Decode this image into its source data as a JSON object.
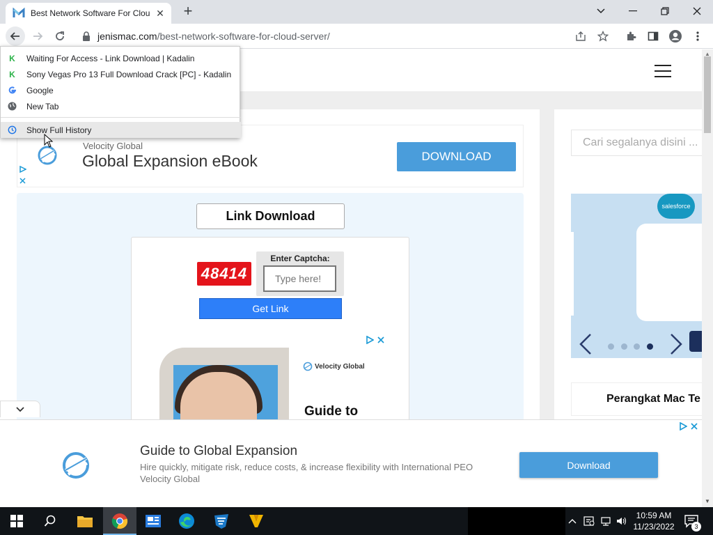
{
  "browser": {
    "tab_title": "Best Network Software For Cloud Server",
    "tab_close": "✕",
    "new_tab": "+",
    "url_host": "jenismac.com",
    "url_path": "/best-network-software-for-cloud-server/"
  },
  "history_menu": {
    "items": [
      {
        "label": "Waiting For Access - Link Download | Kadalin",
        "icon": "kadalin-k-icon"
      },
      {
        "label": "Sony Vegas Pro 13 Full Download Crack [PC] - Kadalin",
        "icon": "kadalin-k-icon"
      },
      {
        "label": "Google",
        "icon": "google-g-icon"
      },
      {
        "label": "New Tab",
        "icon": "globe-icon"
      }
    ],
    "show_full_history": "Show Full History"
  },
  "top_ad": {
    "brand": "Velocity Global",
    "title": "Global Expansion eBook",
    "button": "DOWNLOAD"
  },
  "download": {
    "link_download": "Link Download",
    "captcha_code": "48414",
    "captcha_label": "Enter Captcha:",
    "captcha_placeholder": "Type here!",
    "get_link": "Get Link",
    "inner_ad_brand": "Velocity Global",
    "inner_ad_title": "Guide to"
  },
  "sidebar": {
    "search_placeholder": "Cari segalanya disini ...",
    "salesforce_label": "salesforce",
    "heading": "Perangkat Mac Te"
  },
  "bottom_ad": {
    "title": "Guide to Global Expansion",
    "description": "Hire quickly, mitigate risk, reduce costs, & increase flexibility with International PEO",
    "brand": "Velocity Global",
    "button": "Download"
  },
  "taskbar": {
    "time": "10:59 AM",
    "date": "11/23/2022",
    "notification_count": "3"
  },
  "colors": {
    "accent_blue": "#4a9ddb",
    "get_link_blue": "#2d7ff9",
    "captcha_red": "#e4141b",
    "kadalin_green": "#2db34a"
  }
}
